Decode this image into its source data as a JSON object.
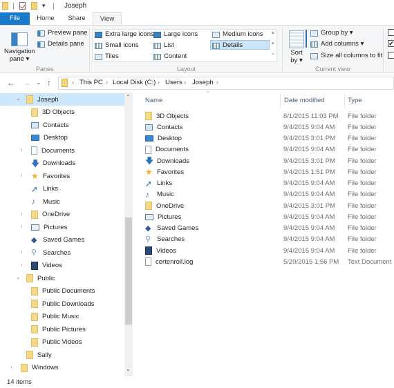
{
  "window": {
    "title": "Joseph"
  },
  "tabs": [
    {
      "label": "File",
      "active": false
    },
    {
      "label": "Home",
      "active": false
    },
    {
      "label": "Share",
      "active": false
    },
    {
      "label": "View",
      "active": true
    }
  ],
  "ribbon": {
    "panes": {
      "label": "Panes",
      "navigation_pane": "Navigation pane",
      "preview_pane": "Preview pane",
      "details_pane": "Details pane"
    },
    "layout": {
      "label": "Layout",
      "options": [
        "Extra large icons",
        "Large icons",
        "Medium icons",
        "Small icons",
        "List",
        "Details",
        "Tiles",
        "Content"
      ],
      "selected": "Details"
    },
    "current_view": {
      "label": "Current view",
      "sort_by": "Sort by",
      "group_by": "Group by",
      "add_columns": "Add columns",
      "size_columns": "Size all columns to fit"
    },
    "checkboxes": [
      false,
      true,
      false
    ]
  },
  "address": {
    "breadcrumbs": [
      "This PC",
      "Local Disk (C:)",
      "Users",
      "Joseph"
    ]
  },
  "nav": {
    "items": [
      {
        "label": "Joseph",
        "icon": "folder",
        "expanded": true,
        "selected": true
      },
      {
        "label": "3D Objects",
        "icon": "folder"
      },
      {
        "label": "Contacts",
        "icon": "contacts"
      },
      {
        "label": "Desktop",
        "icon": "desktop"
      },
      {
        "label": "Documents",
        "icon": "documents",
        "expandable": true
      },
      {
        "label": "Downloads",
        "icon": "downloads"
      },
      {
        "label": "Favorites",
        "icon": "favorites",
        "expandable": true
      },
      {
        "label": "Links",
        "icon": "links"
      },
      {
        "label": "Music",
        "icon": "music"
      },
      {
        "label": "OneDrive",
        "icon": "folder",
        "expandable": true
      },
      {
        "label": "Pictures",
        "icon": "pictures",
        "expandable": true
      },
      {
        "label": "Saved Games",
        "icon": "saved-games"
      },
      {
        "label": "Searches",
        "icon": "searches",
        "expandable": true
      },
      {
        "label": "Videos",
        "icon": "videos",
        "expandable": true
      },
      {
        "label": "Public",
        "icon": "folder",
        "expanded": true
      },
      {
        "label": "Public Documents",
        "icon": "folder"
      },
      {
        "label": "Public Downloads",
        "icon": "folder"
      },
      {
        "label": "Public Music",
        "icon": "folder"
      },
      {
        "label": "Public Pictures",
        "icon": "folder"
      },
      {
        "label": "Public Videos",
        "icon": "folder"
      },
      {
        "label": "Sally",
        "icon": "folder"
      },
      {
        "label": "Windows",
        "icon": "folder",
        "expandable": true
      }
    ]
  },
  "columns": {
    "name": "Name",
    "date": "Date modified",
    "type": "Type"
  },
  "files": [
    {
      "name": "3D Objects",
      "date": "6/1/2015 11:03 PM",
      "type": "File folder",
      "icon": "folder"
    },
    {
      "name": "Contacts",
      "date": "9/4/2015 9:04 AM",
      "type": "File folder",
      "icon": "contacts"
    },
    {
      "name": "Desktop",
      "date": "9/4/2015 3:01 PM",
      "type": "File folder",
      "icon": "desktop"
    },
    {
      "name": "Documents",
      "date": "9/4/2015 9:04 AM",
      "type": "File folder",
      "icon": "documents"
    },
    {
      "name": "Downloads",
      "date": "9/4/2015 3:01 PM",
      "type": "File folder",
      "icon": "downloads"
    },
    {
      "name": "Favorites",
      "date": "9/4/2015 1:51 PM",
      "type": "File folder",
      "icon": "favorites"
    },
    {
      "name": "Links",
      "date": "9/4/2015 9:04 AM",
      "type": "File folder",
      "icon": "links"
    },
    {
      "name": "Music",
      "date": "9/4/2015 9:04 AM",
      "type": "File folder",
      "icon": "music"
    },
    {
      "name": "OneDrive",
      "date": "9/4/2015 3:01 PM",
      "type": "File folder",
      "icon": "folder"
    },
    {
      "name": "Pictures",
      "date": "9/4/2015 9:04 AM",
      "type": "File folder",
      "icon": "pictures"
    },
    {
      "name": "Saved Games",
      "date": "9/4/2015 9:04 AM",
      "type": "File folder",
      "icon": "saved-games"
    },
    {
      "name": "Searches",
      "date": "9/4/2015 9:04 AM",
      "type": "File folder",
      "icon": "searches"
    },
    {
      "name": "Videos",
      "date": "9/4/2015 9:04 AM",
      "type": "File folder",
      "icon": "videos"
    },
    {
      "name": "certenroll.log",
      "date": "5/20/2015 1:56 PM",
      "type": "Text Document",
      "icon": "log"
    }
  ],
  "status": {
    "items": "14 items"
  },
  "glyphs": {
    "back": "←",
    "forward": "→",
    "recent": "⌄",
    "up": "↑",
    "sep": "›",
    "dropdown": "▾",
    "chev_down": "⌄",
    "chev_right": "›"
  }
}
